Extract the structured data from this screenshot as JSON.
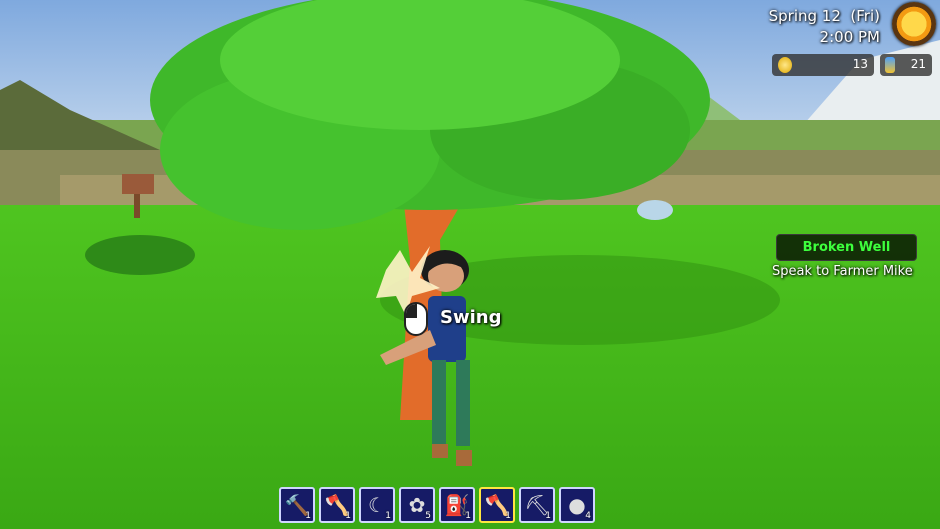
{
  "hud": {
    "season_day": "Spring 12",
    "weekday": "(Fri)",
    "time": "2:00 PM",
    "weather_icon": "sun-icon",
    "coins": "13",
    "gems": "21"
  },
  "quest": {
    "title": "Broken Well",
    "description": "Speak to Farmer Mike"
  },
  "prompt": {
    "icon": "mouse-left-click-icon",
    "label": "Swing"
  },
  "hotbar": [
    {
      "name": "hammer",
      "icon": "hammer-icon",
      "glyph": "🔨",
      "qty": "1",
      "selected": false
    },
    {
      "name": "axe",
      "icon": "axe-icon",
      "glyph": "🪓",
      "qty": "1",
      "selected": false
    },
    {
      "name": "sickle",
      "icon": "sickle-icon",
      "glyph": "☾",
      "qty": "1",
      "selected": false
    },
    {
      "name": "seed-bag",
      "icon": "seed-bag-icon",
      "glyph": "✿",
      "qty": "5",
      "selected": false
    },
    {
      "name": "watering-can",
      "icon": "watering-can-icon",
      "glyph": "⛽",
      "qty": "1",
      "selected": false
    },
    {
      "name": "big-axe",
      "icon": "axe-icon",
      "glyph": "🪓",
      "qty": "1",
      "selected": true
    },
    {
      "name": "pickaxe",
      "icon": "pickaxe-icon",
      "glyph": "⛏",
      "qty": "1",
      "selected": false
    },
    {
      "name": "stone",
      "icon": "stone-icon",
      "glyph": "●",
      "qty": "4",
      "selected": false
    }
  ],
  "colors": {
    "quest_title": "#3dff3d",
    "hotbar_bg": "#161b66",
    "hotbar_selected": "#ffe640"
  }
}
